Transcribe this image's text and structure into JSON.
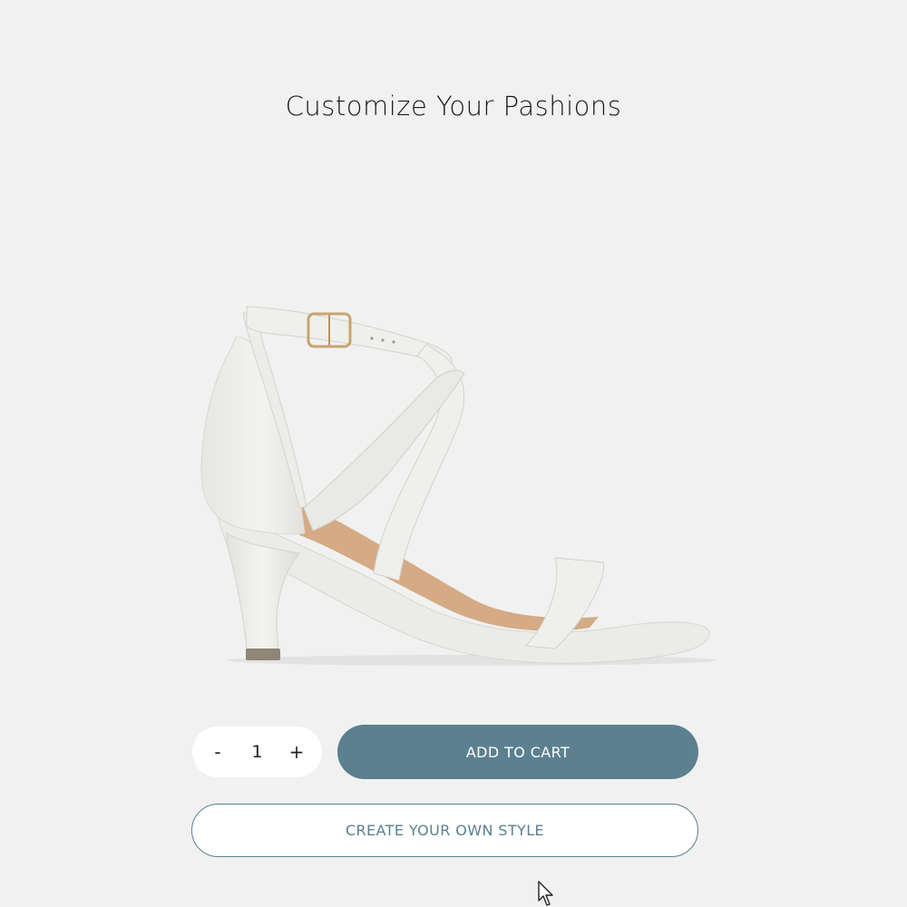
{
  "page": {
    "title": "Customize Your Pashions",
    "background_color": "#f1f1f1"
  },
  "product": {
    "image": "white-strappy-heeled-sandal",
    "color": "#efefec"
  },
  "quantity": {
    "decrement_label": "-",
    "value": "1",
    "increment_label": "+"
  },
  "actions": {
    "add_to_cart_label": "ADD TO CART",
    "create_style_label": "CREATE YOUR OWN STYLE",
    "accent_color": "#5b808f"
  },
  "cursor": {
    "icon": "mouse-pointer-icon"
  }
}
